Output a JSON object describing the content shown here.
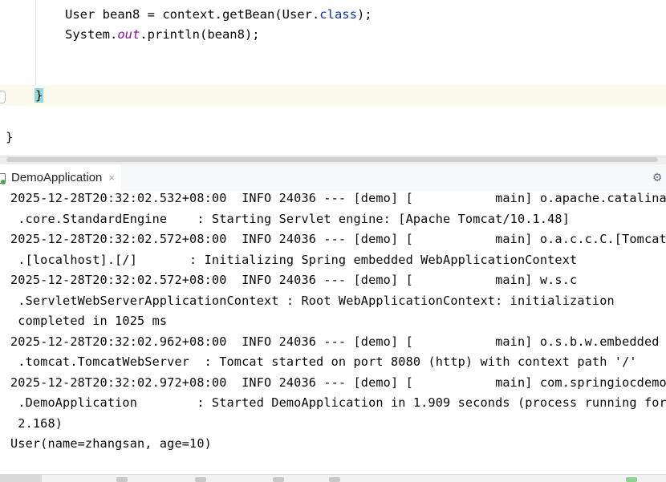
{
  "editor": {
    "lines": [
      "User bean8 = context.getBean(User.class);",
      "System.out.println(bean8);",
      "}",
      "}"
    ],
    "code_line1": {
      "prefix": "User bean8 = context.getBean(User.",
      "keyword": "class",
      "suffix": ");"
    },
    "code_line2": {
      "prefix": "System.",
      "keyword": "out",
      "suffix": ".println(bean8);"
    },
    "brace_method": "}",
    "brace_class": "}"
  },
  "run_panel": {
    "tab_label": "DemoApplication",
    "close_glyph": "×",
    "settings_icon": "gear-icon",
    "settings_glyph": "⚙"
  },
  "console": {
    "lines": [
      "2025-12-28T20:32:02.532+08:00  INFO 24036 --- [demo] [           main] o.apache.catalina",
      " .core.StandardEngine    : Starting Servlet engine: [Apache Tomcat/10.1.48]",
      "2025-12-28T20:32:02.572+08:00  INFO 24036 --- [demo] [           main] o.a.c.c.C.[Tomcat",
      " .[localhost].[/]       : Initializing Spring embedded WebApplicationContext",
      "2025-12-28T20:32:02.572+08:00  INFO 24036 --- [demo] [           main] w.s.c",
      " .ServletWebServerApplicationContext : Root WebApplicationContext: initialization",
      " completed in 1025 ms",
      "2025-12-28T20:32:02.962+08:00  INFO 24036 --- [demo] [           main] o.s.b.w.embedded",
      " .tomcat.TomcatWebServer  : Tomcat started on port 8080 (http) with context path '/'",
      "2025-12-28T20:32:02.972+08:00  INFO 24036 --- [demo] [           main] com.springiocdemo",
      " .DemoApplication        : Started DemoApplication in 1.909 seconds (process running for",
      " 2.168)",
      "User(name=zhangsan, age=10)"
    ]
  },
  "colors": {
    "keyword_blue": "#0033b3",
    "static_field_purple": "#871094",
    "brace_match_bg": "#93d9d9",
    "current_line_bg": "#fcfaed",
    "tab_accent": "#3574f0"
  }
}
